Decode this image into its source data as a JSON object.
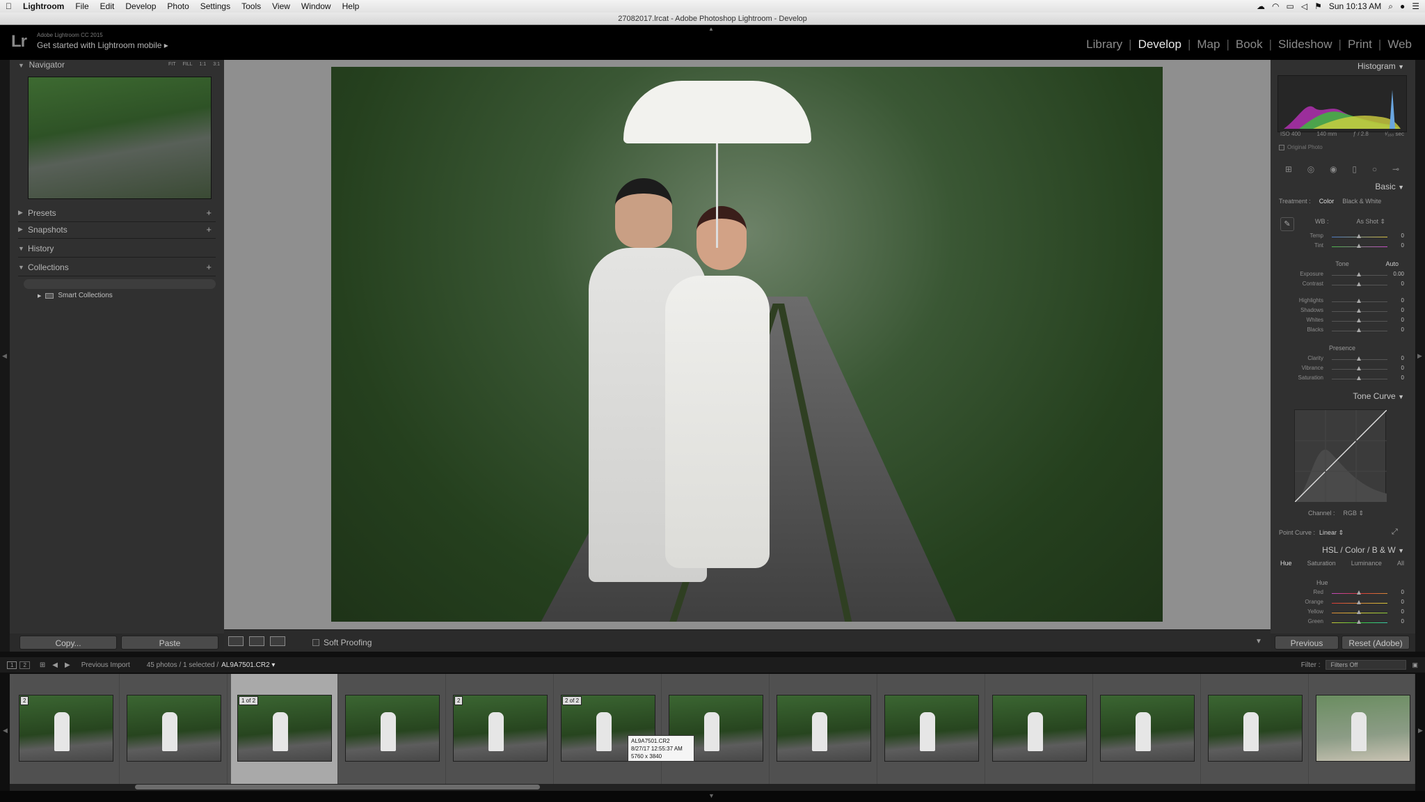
{
  "menubar": {
    "apple": "",
    "items": [
      "Lightroom",
      "File",
      "Edit",
      "Develop",
      "Photo",
      "Settings",
      "Tools",
      "View",
      "Window",
      "Help"
    ],
    "clock": "Sun 10:13 AM"
  },
  "window": {
    "title": "27082017.lrcat - Adobe Photoshop Lightroom - Develop"
  },
  "identity": {
    "logo": "Lr",
    "product": "Adobe Lightroom CC 2015",
    "mobile": "Get started with Lightroom mobile"
  },
  "modules": [
    "Library",
    "Develop",
    "Map",
    "Book",
    "Slideshow",
    "Print",
    "Web"
  ],
  "left_panel": {
    "navigator": {
      "title": "Navigator",
      "opts": [
        "FIT",
        "FILL",
        "1:1",
        "3:1"
      ]
    },
    "presets": "Presets",
    "snapshots": "Snapshots",
    "history": "History",
    "collections": "Collections",
    "smart_collections": "Smart Collections",
    "copy": "Copy...",
    "paste": "Paste"
  },
  "toolbar": {
    "soft_proofing": "Soft Proofing"
  },
  "right_panel": {
    "histogram": {
      "title": "Histogram",
      "iso": "ISO 400",
      "focal": "140 mm",
      "aperture": "ƒ / 2.8",
      "shutter": "¹⁄₁₆₀ sec",
      "original": "Original Photo"
    },
    "basic": {
      "title": "Basic",
      "treatment": "Treatment :",
      "color": "Color",
      "bw": "Black & White",
      "wb": "WB :",
      "wb_val": "As Shot",
      "tone": "Tone",
      "auto": "Auto",
      "presence": "Presence",
      "sliders": [
        {
          "label": "Temp",
          "value": "0"
        },
        {
          "label": "Tint",
          "value": "0"
        },
        {
          "label": "Exposure",
          "value": "0.00"
        },
        {
          "label": "Contrast",
          "value": "0"
        },
        {
          "label": "Highlights",
          "value": "0"
        },
        {
          "label": "Shadows",
          "value": "0"
        },
        {
          "label": "Whites",
          "value": "0"
        },
        {
          "label": "Blacks",
          "value": "0"
        },
        {
          "label": "Clarity",
          "value": "0"
        },
        {
          "label": "Vibrance",
          "value": "0"
        },
        {
          "label": "Saturation",
          "value": "0"
        }
      ]
    },
    "tone_curve": {
      "title": "Tone Curve",
      "channel": "Channel :",
      "channel_val": "RGB",
      "point_curve": "Point Curve :",
      "point_val": "Linear"
    },
    "hsl": {
      "title": "HSL  /  Color  /  B & W",
      "tabs": [
        "Hue",
        "Saturation",
        "Luminance",
        "All"
      ],
      "sub": "Hue",
      "rows": [
        {
          "label": "Red",
          "value": "0"
        },
        {
          "label": "Orange",
          "value": "0"
        },
        {
          "label": "Yellow",
          "value": "0"
        },
        {
          "label": "Green",
          "value": "0"
        }
      ]
    },
    "previous": "Previous",
    "reset": "Reset (Adobe)"
  },
  "filmstrip": {
    "source": "Previous Import",
    "count": "45 photos / 1 selected /",
    "file": "AL9A7501.CR2",
    "filter": "Filter :",
    "filter_val": "Filters Off",
    "badges": [
      "2",
      "1 of 2",
      "2",
      "2 of 2"
    ],
    "tooltip": [
      "AL9A7501.CR2",
      "8/27/17 12:55:37 AM",
      "5760 x 3840"
    ]
  }
}
